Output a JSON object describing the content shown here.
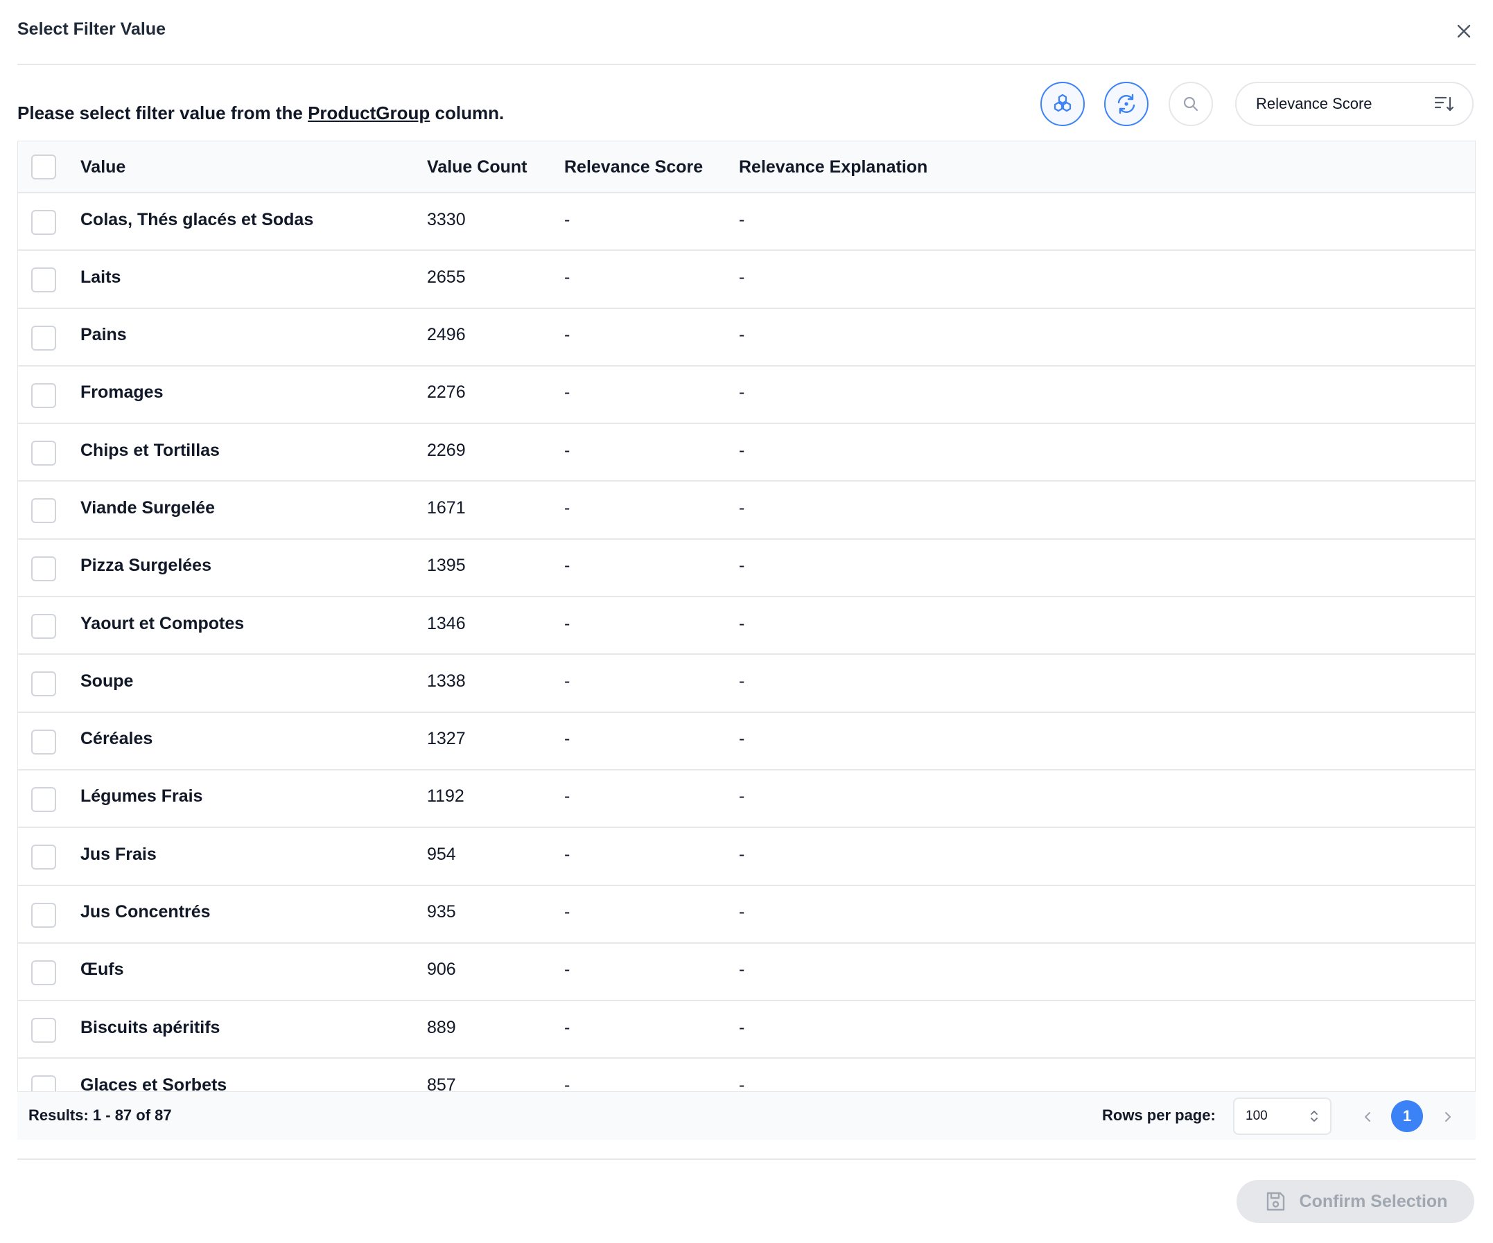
{
  "modal": {
    "title": "Select Filter Value",
    "instruction_prefix": "Please select filter value from the ",
    "instruction_column": "ProductGroup",
    "instruction_suffix": " column.",
    "sort_label": "Relevance Score"
  },
  "icons": {
    "close": "close-icon",
    "hexagon": "hexagon-cluster-icon",
    "refresh": "refresh-icon",
    "search": "search-icon",
    "sort": "sort-descending-icon",
    "save": "save-icon",
    "prev": "chevron-left-icon",
    "next": "chevron-right-icon",
    "updown": "chevron-up-down-icon"
  },
  "colors": {
    "accent": "#3b82f6",
    "border": "#e5e7eb",
    "disabled_text": "#a1a7b0"
  },
  "table": {
    "headers": {
      "value": "Value",
      "count": "Value Count",
      "score": "Relevance Score",
      "explanation": "Relevance Explanation"
    },
    "rows": [
      {
        "value": "Colas, Thés glacés et Sodas",
        "count": "3330",
        "score": "-",
        "explanation": "-"
      },
      {
        "value": "Laits",
        "count": "2655",
        "score": "-",
        "explanation": "-"
      },
      {
        "value": "Pains",
        "count": "2496",
        "score": "-",
        "explanation": "-"
      },
      {
        "value": "Fromages",
        "count": "2276",
        "score": "-",
        "explanation": "-"
      },
      {
        "value": "Chips et Tortillas",
        "count": "2269",
        "score": "-",
        "explanation": "-"
      },
      {
        "value": "Viande Surgelée",
        "count": "1671",
        "score": "-",
        "explanation": "-"
      },
      {
        "value": "Pizza Surgelées",
        "count": "1395",
        "score": "-",
        "explanation": "-"
      },
      {
        "value": "Yaourt et Compotes",
        "count": "1346",
        "score": "-",
        "explanation": "-"
      },
      {
        "value": "Soupe",
        "count": "1338",
        "score": "-",
        "explanation": "-"
      },
      {
        "value": "Céréales",
        "count": "1327",
        "score": "-",
        "explanation": "-"
      },
      {
        "value": "Légumes Frais",
        "count": "1192",
        "score": "-",
        "explanation": "-"
      },
      {
        "value": "Jus Frais",
        "count": "954",
        "score": "-",
        "explanation": "-"
      },
      {
        "value": "Jus Concentrés",
        "count": "935",
        "score": "-",
        "explanation": "-"
      },
      {
        "value": "Œufs",
        "count": "906",
        "score": "-",
        "explanation": "-"
      },
      {
        "value": "Biscuits apéritifs",
        "count": "889",
        "score": "-",
        "explanation": "-"
      },
      {
        "value": "Glaces et Sorbets",
        "count": "857",
        "score": "-",
        "explanation": "-"
      }
    ]
  },
  "pagination": {
    "results": "Results: 1 - 87 of 87",
    "rows_per_page_label": "Rows per page:",
    "rows_per_page_value": "100",
    "current_page": "1"
  },
  "footer": {
    "confirm_label": "Confirm Selection"
  }
}
